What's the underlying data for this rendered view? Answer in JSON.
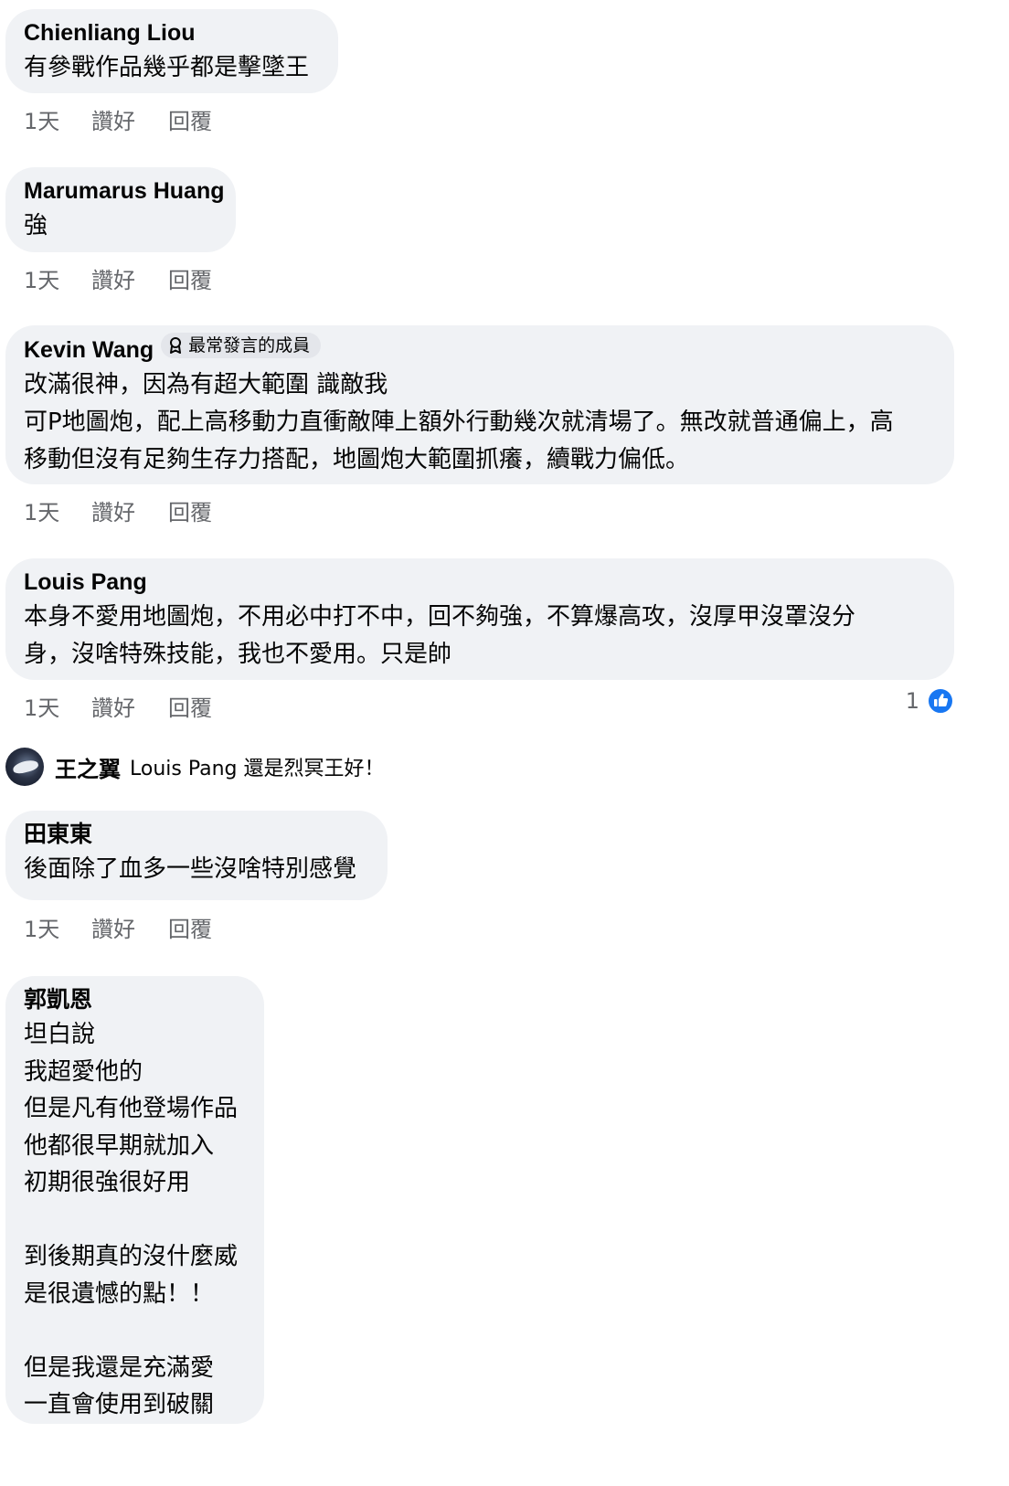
{
  "comments": [
    {
      "author": "Chienliang Liou",
      "text": "有參戰作品幾乎都是擊墜王",
      "time": "1天",
      "like": "讚好",
      "reply": "回覆"
    },
    {
      "author": "Marumarus Huang",
      "text": "強",
      "time": "1天",
      "like": "讚好",
      "reply": "回覆"
    },
    {
      "author": "Kevin Wang",
      "badge": "最常發言的成員",
      "text": "改滿很神，因為有超大範圍 識敵我\n可P地圖炮，配上高移動力直衝敵陣上額外行動幾次就清場了。無改就普通偏上，高\n移動但沒有足夠生存力搭配，地圖炮大範圍抓癢，續戰力偏低。",
      "time": "1天",
      "like": "讚好",
      "reply": "回覆"
    },
    {
      "author": "Louis Pang",
      "text": "本身不愛用地圖炮，不用必中打不中，回不夠強，不算爆高攻，沒厚甲沒罩沒分\n身，沒啥特殊技能，我也不愛用。只是帥",
      "time": "1天",
      "like": "讚好",
      "reply": "回覆",
      "reaction_count": "1",
      "reaction_icon": "like-icon",
      "reply_preview": {
        "author": "王之翼",
        "text": "Louis Pang 還是烈冥王好！"
      }
    },
    {
      "author": "田東東",
      "text": "後面除了血多一些沒啥特別感覺",
      "time": "1天",
      "like": "讚好",
      "reply": "回覆"
    },
    {
      "author": "郭凱恩",
      "text": "坦白說\n我超愛他的\n但是凡有他登場作品\n他都很早期就加入\n初期很強很好用\n\n到後期真的沒什麼威\n是很遺憾的點！！\n\n但是我還是充滿愛\n一直會使用到破關"
    }
  ],
  "colors": {
    "bubble": "#f0f2f5",
    "meta_text": "#65676b",
    "like_blue": "#1877f2"
  }
}
